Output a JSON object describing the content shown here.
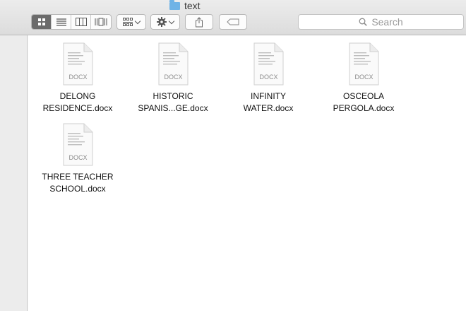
{
  "window": {
    "title": "text",
    "folder_icon": "folder-icon"
  },
  "toolbar": {
    "view_modes": [
      {
        "name": "icon-view",
        "icon": "grid-icon",
        "selected": true
      },
      {
        "name": "list-view",
        "icon": "list-icon",
        "selected": false
      },
      {
        "name": "column-view",
        "icon": "columns-icon",
        "selected": false
      },
      {
        "name": "cover-flow-view",
        "icon": "cover-flow-icon",
        "selected": false
      }
    ],
    "arrange_icon": "arrange-icon",
    "action_icon": "gear-icon",
    "share_icon": "share-icon",
    "tag_icon": "tag-icon",
    "search_placeholder": "Search"
  },
  "files": [
    {
      "name": "DELONG\nRESIDENCE.docx",
      "type": "DOCX"
    },
    {
      "name": "HISTORIC\nSPANIS...GE.docx",
      "type": "DOCX"
    },
    {
      "name": "INFINITY\nWATER.docx",
      "type": "DOCX"
    },
    {
      "name": "OSCEOLA\nPERGOLA.docx",
      "type": "DOCX"
    },
    {
      "name": "THREE TEACHER\nSCHOOL.docx",
      "type": "DOCX"
    }
  ],
  "colors": {
    "folder": "#6fb3e6",
    "selected_segment": "#6b6b6b"
  }
}
